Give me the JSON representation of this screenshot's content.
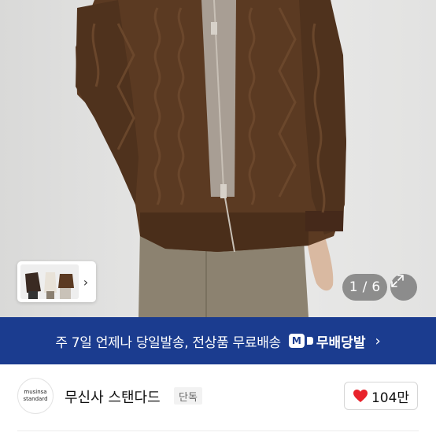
{
  "gallery": {
    "current_page": "1",
    "separator": "/",
    "total_pages": "6",
    "thumbnail_arrow": "›",
    "icons": {
      "expand": "expand-icon",
      "next": "chevron-right-icon"
    }
  },
  "shipping_banner": {
    "text": "주 7일 언제나 당일발송, 전상품 무료배송",
    "badge_mark": "M",
    "badge_label": "무배당발",
    "chevron": "›",
    "background_color": "#1b3c8f"
  },
  "brand": {
    "logo_line1": "musinsa",
    "logo_line2": "standard",
    "name": "무신사 스탠다드",
    "exclusive_label": "단독",
    "like_count": "104만",
    "heart_color": "#e8222b"
  }
}
